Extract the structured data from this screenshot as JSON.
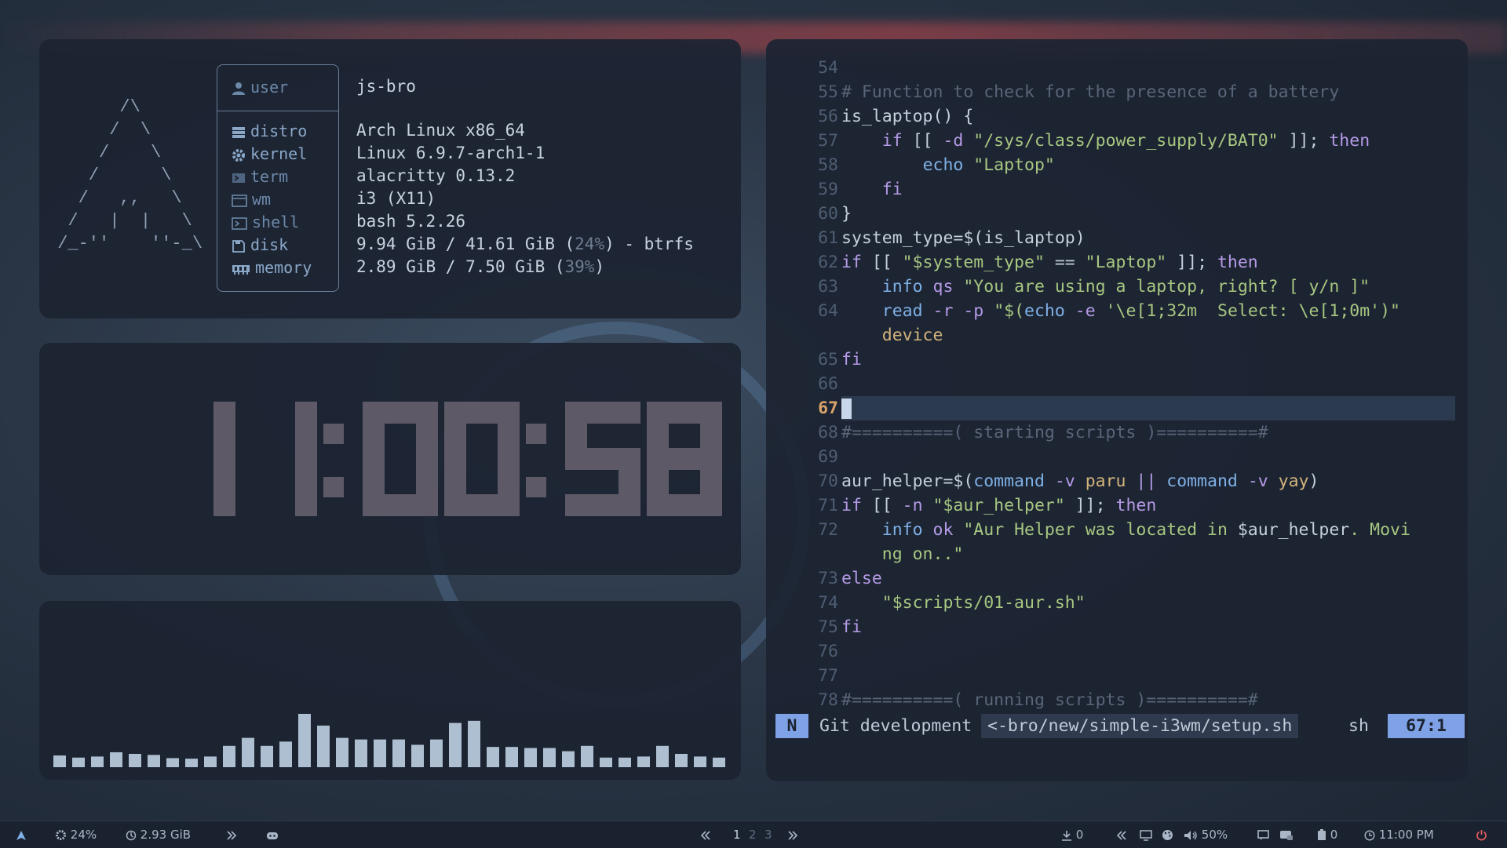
{
  "fetch": {
    "user_label": "user",
    "user_value": "js-bro",
    "rows": [
      {
        "label": "distro",
        "value": "Arch Linux x86_64"
      },
      {
        "label": "kernel",
        "value": "Linux 6.9.7-arch1-1"
      },
      {
        "label": "term",
        "value": "alacritty 0.13.2"
      },
      {
        "label": "wm",
        "value": "i3 (X11)"
      },
      {
        "label": "shell",
        "value": "bash 5.2.26"
      },
      {
        "label": "disk",
        "value_pre": "9.94 GiB / 41.61 GiB (",
        "value_pct": "24%",
        "value_post": ") - btrfs"
      },
      {
        "label": "memory",
        "value_pre": "2.89 GiB / 7.50 GiB (",
        "value_pct": "39%",
        "value_post": ")"
      }
    ]
  },
  "clock": {
    "time": "11:00:58"
  },
  "visualizer": {
    "levels": [
      0.22,
      0.18,
      0.2,
      0.28,
      0.25,
      0.23,
      0.17,
      0.16,
      0.2,
      0.4,
      0.55,
      0.4,
      0.48,
      1.0,
      0.78,
      0.55,
      0.52,
      0.52,
      0.52,
      0.42,
      0.52,
      0.83,
      0.87,
      0.38,
      0.38,
      0.36,
      0.36,
      0.3,
      0.4,
      0.18,
      0.18,
      0.2,
      0.4,
      0.25,
      0.2,
      0.18
    ]
  },
  "editor": {
    "lines": [
      {
        "n": "54",
        "tokens": []
      },
      {
        "n": "55",
        "tokens": [
          {
            "c": "comment",
            "t": "# Function to check for the presence of a battery"
          }
        ]
      },
      {
        "n": "56",
        "tokens": [
          {
            "c": "op",
            "t": "is_laptop() {"
          }
        ]
      },
      {
        "n": "57",
        "tokens": [
          {
            "c": "op",
            "t": "    "
          },
          {
            "c": "kw",
            "t": "if"
          },
          {
            "c": "op",
            "t": " [[ "
          },
          {
            "c": "kw",
            "t": "-d"
          },
          {
            "c": "op",
            "t": " "
          },
          {
            "c": "str",
            "t": "\"/sys/class/power_supply/BAT0\""
          },
          {
            "c": "op",
            "t": " ]]; "
          },
          {
            "c": "kw",
            "t": "then"
          }
        ]
      },
      {
        "n": "58",
        "tokens": [
          {
            "c": "op",
            "t": "        "
          },
          {
            "c": "fn",
            "t": "echo"
          },
          {
            "c": "op",
            "t": " "
          },
          {
            "c": "str",
            "t": "\"Laptop\""
          }
        ]
      },
      {
        "n": "59",
        "tokens": [
          {
            "c": "op",
            "t": "    "
          },
          {
            "c": "kw",
            "t": "fi"
          }
        ]
      },
      {
        "n": "60",
        "tokens": [
          {
            "c": "op",
            "t": "}"
          }
        ]
      },
      {
        "n": "61",
        "tokens": [
          {
            "c": "op",
            "t": "system_type=$(is_laptop)"
          }
        ]
      },
      {
        "n": "62",
        "tokens": [
          {
            "c": "kw",
            "t": "if"
          },
          {
            "c": "op",
            "t": " [[ "
          },
          {
            "c": "str",
            "t": "\"$system_type\""
          },
          {
            "c": "op",
            "t": " == "
          },
          {
            "c": "str",
            "t": "\"Laptop\""
          },
          {
            "c": "op",
            "t": " ]]; "
          },
          {
            "c": "kw",
            "t": "then"
          }
        ]
      },
      {
        "n": "63",
        "tokens": [
          {
            "c": "op",
            "t": "    "
          },
          {
            "c": "fn",
            "t": "info"
          },
          {
            "c": "op",
            "t": " "
          },
          {
            "c": "kw",
            "t": "qs"
          },
          {
            "c": "op",
            "t": " "
          },
          {
            "c": "str",
            "t": "\"You are using a laptop, right? [ y/n ]\""
          }
        ]
      },
      {
        "n": "64",
        "tokens": [
          {
            "c": "op",
            "t": "    "
          },
          {
            "c": "fn",
            "t": "read"
          },
          {
            "c": "op",
            "t": " "
          },
          {
            "c": "kw",
            "t": "-r"
          },
          {
            "c": "op",
            "t": " "
          },
          {
            "c": "kw",
            "t": "-p"
          },
          {
            "c": "op",
            "t": " "
          },
          {
            "c": "str",
            "t": "\"$("
          },
          {
            "c": "fn",
            "t": "echo"
          },
          {
            "c": "op",
            "t": " "
          },
          {
            "c": "kw",
            "t": "-e"
          },
          {
            "c": "op",
            "t": " "
          },
          {
            "c": "str",
            "t": "'\\e[1;32m  Select: \\e[1;0m')\""
          }
        ]
      },
      {
        "n": "",
        "tokens": [
          {
            "c": "op",
            "t": "    "
          },
          {
            "c": "var",
            "t": "device"
          }
        ]
      },
      {
        "n": "65",
        "tokens": [
          {
            "c": "kw",
            "t": "fi"
          }
        ]
      },
      {
        "n": "66",
        "tokens": []
      },
      {
        "n": "67",
        "tokens": [],
        "current": true
      },
      {
        "n": "68",
        "tokens": [
          {
            "c": "comment",
            "t": "#==========( starting scripts )==========#"
          }
        ]
      },
      {
        "n": "69",
        "tokens": []
      },
      {
        "n": "70",
        "tokens": [
          {
            "c": "op",
            "t": "aur_helper=$("
          },
          {
            "c": "fn",
            "t": "command"
          },
          {
            "c": "op",
            "t": " "
          },
          {
            "c": "kw",
            "t": "-v"
          },
          {
            "c": "op",
            "t": " "
          },
          {
            "c": "var",
            "t": "paru"
          },
          {
            "c": "op",
            "t": " "
          },
          {
            "c": "kw",
            "t": "||"
          },
          {
            "c": "op",
            "t": " "
          },
          {
            "c": "fn",
            "t": "command"
          },
          {
            "c": "op",
            "t": " "
          },
          {
            "c": "kw",
            "t": "-v"
          },
          {
            "c": "op",
            "t": " "
          },
          {
            "c": "var",
            "t": "yay"
          },
          {
            "c": "op",
            "t": ")"
          }
        ]
      },
      {
        "n": "71",
        "tokens": [
          {
            "c": "kw",
            "t": "if"
          },
          {
            "c": "op",
            "t": " [[ "
          },
          {
            "c": "kw",
            "t": "-n"
          },
          {
            "c": "op",
            "t": " "
          },
          {
            "c": "str",
            "t": "\"$aur_helper\""
          },
          {
            "c": "op",
            "t": " ]]; "
          },
          {
            "c": "kw",
            "t": "then"
          }
        ]
      },
      {
        "n": "72",
        "tokens": [
          {
            "c": "op",
            "t": "    "
          },
          {
            "c": "fn",
            "t": "info"
          },
          {
            "c": "op",
            "t": " "
          },
          {
            "c": "kw",
            "t": "ok"
          },
          {
            "c": "op",
            "t": " "
          },
          {
            "c": "str",
            "t": "\"Aur Helper was located in "
          },
          {
            "c": "op",
            "t": "$aur_helper"
          },
          {
            "c": "str",
            "t": ". Movi"
          }
        ]
      },
      {
        "n": "",
        "tokens": [
          {
            "c": "op",
            "t": "    "
          },
          {
            "c": "str",
            "t": "ng on..\""
          }
        ]
      },
      {
        "n": "73",
        "tokens": [
          {
            "c": "kw",
            "t": "else"
          }
        ]
      },
      {
        "n": "74",
        "tokens": [
          {
            "c": "op",
            "t": "    "
          },
          {
            "c": "str",
            "t": "\"$scripts/01-aur.sh\""
          }
        ]
      },
      {
        "n": "75",
        "tokens": [
          {
            "c": "kw",
            "t": "fi"
          }
        ]
      },
      {
        "n": "76",
        "tokens": []
      },
      {
        "n": "77",
        "tokens": []
      },
      {
        "n": "78",
        "tokens": [
          {
            "c": "comment",
            "t": "#==========( running scripts )==========#"
          }
        ]
      }
    ],
    "status": {
      "mode": "N",
      "branch": "Git development",
      "file": "<-bro/new/simple-i3wm/setup.sh",
      "filetype": "sh",
      "position": "67:1"
    }
  },
  "taskbar": {
    "cpu": "24%",
    "memory": "2.93 GiB",
    "workspaces": [
      "1",
      "2",
      "3"
    ],
    "updates": "0",
    "volume": "50%",
    "battery": "0",
    "time": "11:00 PM"
  }
}
